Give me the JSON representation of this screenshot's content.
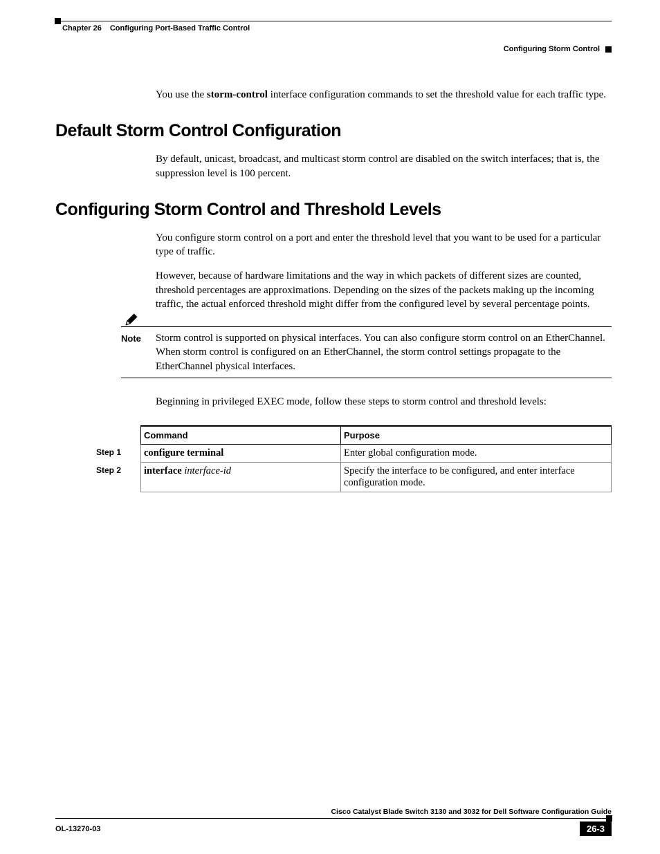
{
  "header": {
    "chapter": "Chapter 26",
    "chapterTitle": "Configuring Port-Based Traffic Control",
    "section": "Configuring Storm Control"
  },
  "intro": {
    "pre": "You use the ",
    "bold": "storm-control",
    "post": " interface configuration commands to set the threshold value for each traffic type."
  },
  "s1": {
    "title": "Default Storm Control Configuration",
    "p1": "By default, unicast, broadcast, and multicast storm control are disabled on the switch interfaces; that is, the suppression level is 100 percent."
  },
  "s2": {
    "title": "Configuring Storm Control and Threshold Levels",
    "p1": "You configure storm control on a port and enter the threshold level that you want to be used for a particular type of traffic.",
    "p2": "However, because of hardware limitations and the way in which packets of different sizes are counted, threshold percentages are approximations. Depending on the sizes of the packets making up the incoming traffic, the actual enforced threshold might differ from the configured level by several percentage points.",
    "noteLabel": "Note",
    "note": "Storm control is supported on physical interfaces. You can also configure storm control on an EtherChannel. When storm control is configured on an EtherChannel, the storm control settings propagate to the EtherChannel physical interfaces.",
    "p3": "Beginning in privileged EXEC mode, follow these steps to storm control and threshold levels:"
  },
  "table": {
    "head": {
      "command": "Command",
      "purpose": "Purpose"
    },
    "rows": [
      {
        "step": "Step 1",
        "cmdBold": "configure terminal",
        "cmdItal": "",
        "purpose": "Enter global configuration mode."
      },
      {
        "step": "Step 2",
        "cmdBold": "interface",
        "cmdItal": " interface-id",
        "purpose": "Specify the interface to be configured, and enter interface configuration mode."
      }
    ]
  },
  "footer": {
    "title": "Cisco Catalyst Blade Switch 3130 and 3032 for Dell Software Configuration Guide",
    "doc": "OL-13270-03",
    "page": "26-3"
  }
}
